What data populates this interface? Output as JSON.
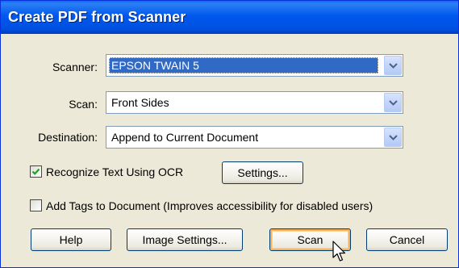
{
  "window": {
    "title": "Create PDF from Scanner"
  },
  "fields": {
    "scanner": {
      "label": "Scanner:",
      "value": "EPSON TWAIN 5"
    },
    "scan": {
      "label": "Scan:",
      "value": "Front Sides"
    },
    "destination": {
      "label": "Destination:",
      "value": "Append to Current Document"
    }
  },
  "options": {
    "ocr": {
      "label": "Recognize Text Using OCR",
      "checked": true
    },
    "settings_button": "Settings...",
    "tags": {
      "label": "Add Tags to Document (Improves accessibility for disabled users)",
      "checked": false
    }
  },
  "buttons": {
    "help": "Help",
    "image_settings": "Image Settings...",
    "scan": "Scan",
    "cancel": "Cancel"
  },
  "colors": {
    "titlebar": "#0058ee",
    "selection": "#316ac5",
    "dialog_bg": "#ece9d8",
    "default_button_glow": "#f8b35a"
  },
  "icons": {
    "dropdown": "chevron-down-icon",
    "check": "checkmark-icon",
    "cursor": "mouse-pointer-icon"
  }
}
